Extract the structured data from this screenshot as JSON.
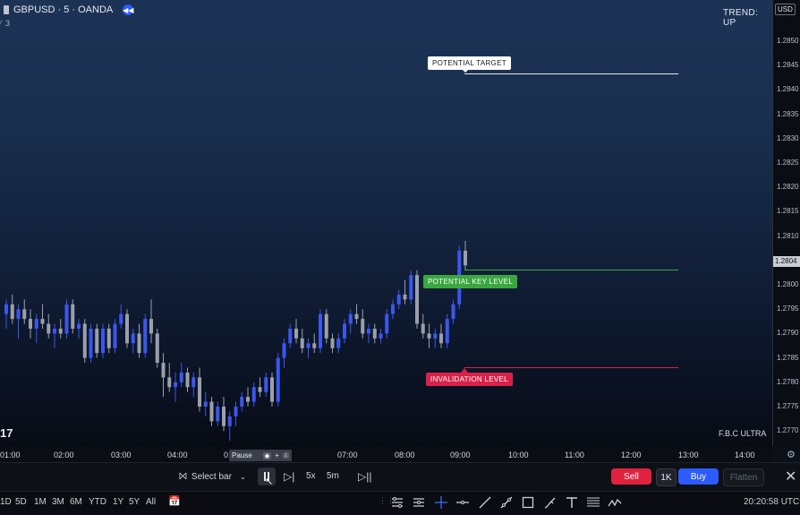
{
  "header": {
    "symbol": "GBPUSD · 5 · OANDA",
    "sub_value": "3",
    "trend": "TREND: UP",
    "currency": "USD",
    "watermark": "F.B.C ULTRA",
    "left_edge_text": "17"
  },
  "price_axis": {
    "labels": [
      "1.2850",
      "1.2845",
      "1.2840",
      "1.2835",
      "1.2830",
      "1.2825",
      "1.2820",
      "1.2815",
      "1.2810",
      "1.2800",
      "1.2795",
      "1.2790",
      "1.2785",
      "1.2780",
      "1.2775",
      "1.2770"
    ],
    "current_price": "1.2804"
  },
  "time_axis": {
    "labels": [
      "01:00",
      "02:00",
      "03:00",
      "04:00",
      "0",
      "07:00",
      "08:00",
      "09:00",
      "10:00",
      "11:00",
      "12:00",
      "13:00",
      "14:00"
    ]
  },
  "annotations": {
    "target": "POTENTIAL TARGET",
    "key_level": "POTENTIAL KEY LEVEL",
    "invalidation": "INVALIDATION LEVEL"
  },
  "replay": {
    "select_bar": "Select bar",
    "pause_tooltip": "Pause",
    "shortcut_plus": "+",
    "speed": "5x",
    "interval": "5m",
    "sell": "Sell",
    "qty": "1K",
    "buy": "Buy",
    "flatten": "Flatten"
  },
  "bottom": {
    "timeframes": [
      "1D",
      "5D",
      "1M",
      "3M",
      "6M",
      "YTD",
      "1Y",
      "5Y",
      "All"
    ],
    "clock": "20:20:58 UTC+"
  },
  "colors": {
    "bull": "#3b57f0",
    "bear": "#9aa0aa",
    "buy": "#2c5cff",
    "sell": "#e0223f",
    "key_level": "#3aa73f",
    "invalidation": "#d9214a"
  },
  "chart_data": {
    "type": "candlestick",
    "symbol": "GBPUSD",
    "interval": "5m",
    "levels": {
      "potential_target": 1.2843,
      "potential_key_level": 1.2803,
      "invalidation_level": 1.2784
    },
    "current_price": 1.2804,
    "ylim": [
      1.2767,
      1.2853
    ],
    "candles": [
      [
        1.2794,
        1.2797,
        1.2791,
        1.2796
      ],
      [
        1.2796,
        1.2798,
        1.2792,
        1.2793
      ],
      [
        1.2793,
        1.2796,
        1.2789,
        1.2795
      ],
      [
        1.2795,
        1.2797,
        1.2792,
        1.2793
      ],
      [
        1.2793,
        1.2795,
        1.2789,
        1.2791
      ],
      [
        1.2791,
        1.2794,
        1.2788,
        1.2793
      ],
      [
        1.2793,
        1.2796,
        1.2791,
        1.2792
      ],
      [
        1.2792,
        1.2794,
        1.2789,
        1.279
      ],
      [
        1.279,
        1.2792,
        1.2787,
        1.2791
      ],
      [
        1.2791,
        1.2793,
        1.2789,
        1.279
      ],
      [
        1.279,
        1.2797,
        1.2789,
        1.2796
      ],
      [
        1.2796,
        1.2797,
        1.279,
        1.2791
      ],
      [
        1.2791,
        1.2793,
        1.2789,
        1.2792
      ],
      [
        1.2792,
        1.2793,
        1.2784,
        1.2785
      ],
      [
        1.2785,
        1.2792,
        1.2784,
        1.2791
      ],
      [
        1.2791,
        1.2792,
        1.2785,
        1.2786
      ],
      [
        1.2786,
        1.2792,
        1.2785,
        1.2791
      ],
      [
        1.2791,
        1.2792,
        1.2786,
        1.2787
      ],
      [
        1.2787,
        1.2793,
        1.2786,
        1.2792
      ],
      [
        1.2792,
        1.2796,
        1.2791,
        1.2794
      ],
      [
        1.2794,
        1.2795,
        1.2787,
        1.2788
      ],
      [
        1.2788,
        1.2791,
        1.2786,
        1.279
      ],
      [
        1.279,
        1.2792,
        1.2785,
        1.2786
      ],
      [
        1.2786,
        1.2794,
        1.2785,
        1.2793
      ],
      [
        1.2793,
        1.2797,
        1.2788,
        1.279
      ],
      [
        1.279,
        1.2791,
        1.2783,
        1.2784
      ],
      [
        1.2784,
        1.2786,
        1.2777,
        1.2781
      ],
      [
        1.2781,
        1.2784,
        1.2778,
        1.2779
      ],
      [
        1.2779,
        1.2782,
        1.2776,
        1.278
      ],
      [
        1.278,
        1.2784,
        1.2779,
        1.2782
      ],
      [
        1.2782,
        1.2783,
        1.2778,
        1.2779
      ],
      [
        1.2779,
        1.2782,
        1.2777,
        1.2781
      ],
      [
        1.2781,
        1.2783,
        1.2774,
        1.2775
      ],
      [
        1.2775,
        1.2778,
        1.2773,
        1.2776
      ],
      [
        1.2776,
        1.2777,
        1.2771,
        1.2772
      ],
      [
        1.2772,
        1.2776,
        1.2771,
        1.2775
      ],
      [
        1.2775,
        1.2777,
        1.277,
        1.2771
      ],
      [
        1.2771,
        1.2774,
        1.2768,
        1.2773
      ],
      [
        1.2773,
        1.2776,
        1.2771,
        1.2775
      ],
      [
        1.2775,
        1.2778,
        1.2774,
        1.2777
      ],
      [
        1.2777,
        1.2779,
        1.2775,
        1.2776
      ],
      [
        1.2776,
        1.278,
        1.2775,
        1.2779
      ],
      [
        1.2779,
        1.2781,
        1.2777,
        1.2778
      ],
      [
        1.2778,
        1.2782,
        1.2777,
        1.2781
      ],
      [
        1.2781,
        1.2782,
        1.2775,
        1.2776
      ],
      [
        1.2776,
        1.2786,
        1.2775,
        1.2785
      ],
      [
        1.2785,
        1.2789,
        1.2783,
        1.2788
      ],
      [
        1.2788,
        1.2792,
        1.2787,
        1.2791
      ],
      [
        1.2791,
        1.2793,
        1.2788,
        1.2789
      ],
      [
        1.2789,
        1.2791,
        1.2786,
        1.2787
      ],
      [
        1.2787,
        1.2789,
        1.2785,
        1.2788
      ],
      [
        1.2788,
        1.279,
        1.2786,
        1.2787
      ],
      [
        1.2787,
        1.2795,
        1.2786,
        1.2794
      ],
      [
        1.2794,
        1.2795,
        1.2788,
        1.2789
      ],
      [
        1.2789,
        1.279,
        1.2786,
        1.2787
      ],
      [
        1.2787,
        1.279,
        1.2786,
        1.2789
      ],
      [
        1.2789,
        1.2793,
        1.2788,
        1.2792
      ],
      [
        1.2792,
        1.2795,
        1.279,
        1.2794
      ],
      [
        1.2794,
        1.2796,
        1.2792,
        1.2793
      ],
      [
        1.2793,
        1.2795,
        1.2789,
        1.279
      ],
      [
        1.279,
        1.2792,
        1.2788,
        1.2791
      ],
      [
        1.2791,
        1.2792,
        1.2788,
        1.2789
      ],
      [
        1.2789,
        1.2791,
        1.2788,
        1.279
      ],
      [
        1.279,
        1.2795,
        1.2789,
        1.2794
      ],
      [
        1.2794,
        1.2797,
        1.2793,
        1.2796
      ],
      [
        1.2796,
        1.2799,
        1.2795,
        1.2798
      ],
      [
        1.2798,
        1.2801,
        1.2796,
        1.2797
      ],
      [
        1.2797,
        1.2803,
        1.2796,
        1.2802
      ],
      [
        1.2802,
        1.2803,
        1.2791,
        1.2792
      ],
      [
        1.2792,
        1.2794,
        1.2789,
        1.279
      ],
      [
        1.279,
        1.2792,
        1.2787,
        1.2789
      ],
      [
        1.2789,
        1.2791,
        1.2787,
        1.279
      ],
      [
        1.279,
        1.2792,
        1.2787,
        1.2788
      ],
      [
        1.2788,
        1.2794,
        1.2787,
        1.2793
      ],
      [
        1.2793,
        1.2797,
        1.2792,
        1.2796
      ],
      [
        1.2796,
        1.2808,
        1.2795,
        1.2807
      ],
      [
        1.2807,
        1.2809,
        1.2803,
        1.2804
      ]
    ]
  }
}
